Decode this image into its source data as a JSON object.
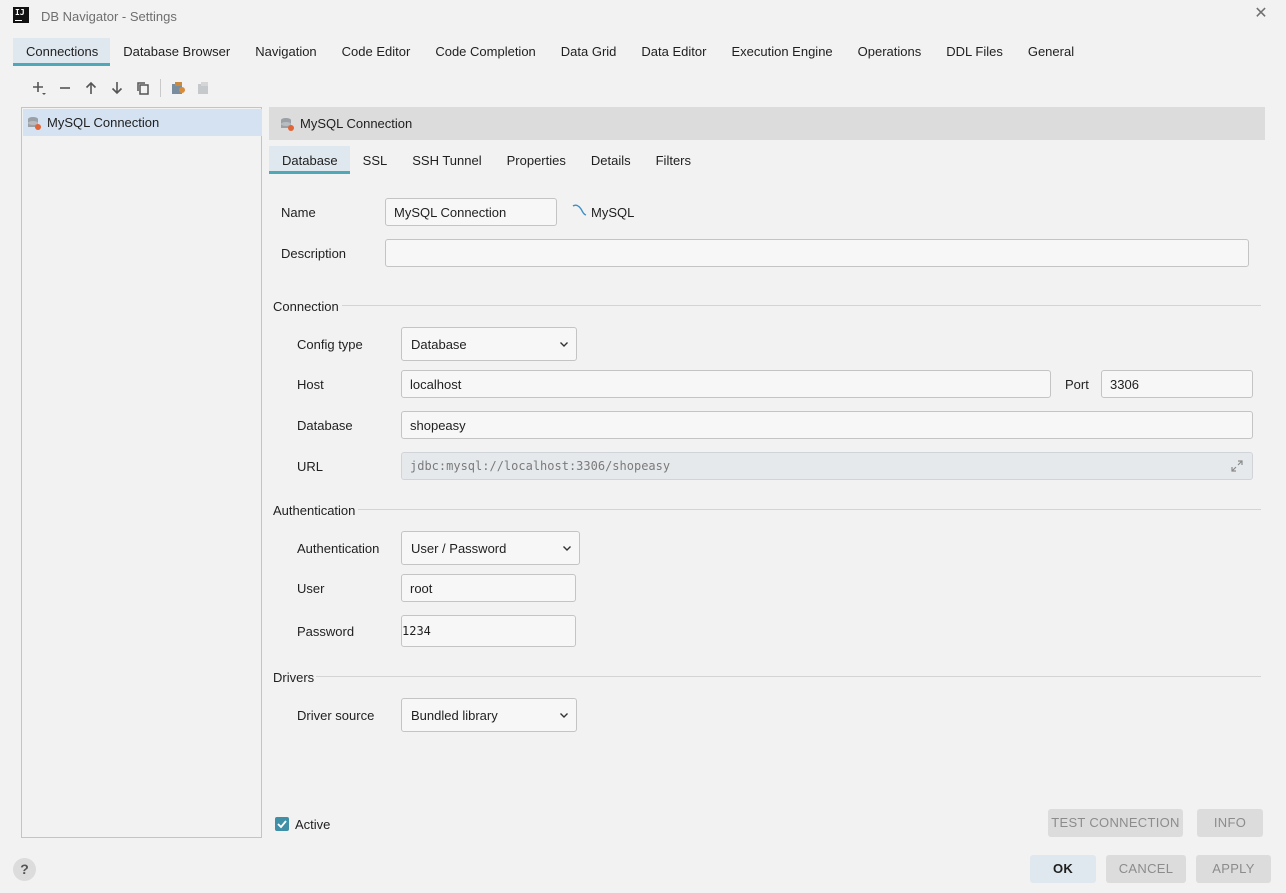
{
  "window": {
    "title": "DB Navigator - Settings",
    "app_icon_text": "IJ"
  },
  "top_tabs": [
    "Connections",
    "Database Browser",
    "Navigation",
    "Code Editor",
    "Code Completion",
    "Data Grid",
    "Data Editor",
    "Execution Engine",
    "Operations",
    "DDL Files",
    "General"
  ],
  "active_top_tab": "Connections",
  "connections_list": [
    {
      "label": "MySQL Connection",
      "selected": true
    }
  ],
  "detail": {
    "header": "MySQL Connection",
    "sub_tabs": [
      "Database",
      "SSL",
      "SSH Tunnel",
      "Properties",
      "Details",
      "Filters"
    ],
    "active_sub_tab": "Database",
    "name_label": "Name",
    "name_value": "MySQL Connection",
    "db_type": "MySQL",
    "description_label": "Description",
    "description_value": "",
    "connection_section": "Connection",
    "config_type_label": "Config type",
    "config_type_value": "Database",
    "host_label": "Host",
    "host_value": "localhost",
    "port_label": "Port",
    "port_value": "3306",
    "database_label": "Database",
    "database_value": "shopeasy",
    "url_label": "URL",
    "url_value": "jdbc:mysql://localhost:3306/shopeasy",
    "auth_section": "Authentication",
    "auth_label": "Authentication",
    "auth_value": "User / Password",
    "user_label": "User",
    "user_value": "root",
    "password_label": "Password",
    "password_value": "1234",
    "drivers_section": "Drivers",
    "driver_source_label": "Driver source",
    "driver_source_value": "Bundled library",
    "active_label": "Active",
    "active_checked": true
  },
  "buttons": {
    "test_connection": "TEST CONNECTION",
    "info": "INFO",
    "ok": "OK",
    "cancel": "CANCEL",
    "apply": "APPLY",
    "help": "?"
  },
  "colors": {
    "accent": "#4fa8b6",
    "selection": "#d4e2f1",
    "checkbox": "#3f8fa7"
  }
}
